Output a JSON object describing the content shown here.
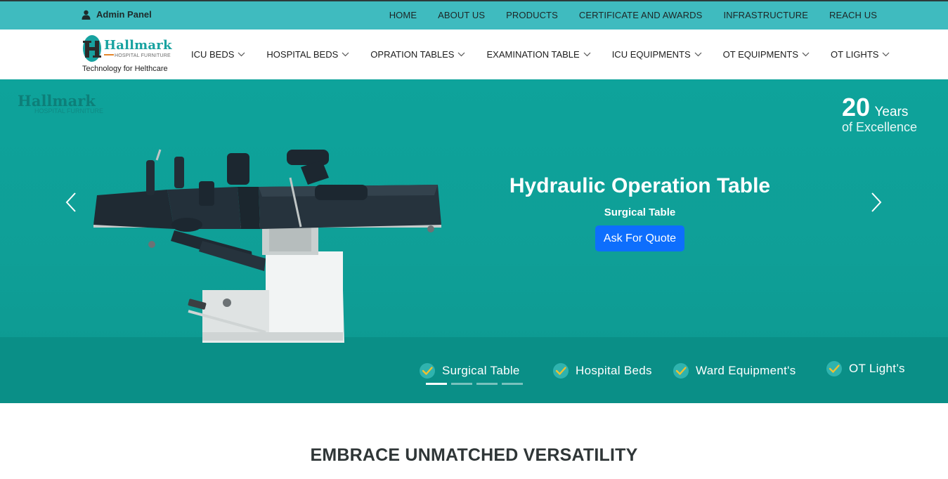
{
  "topbar": {
    "admin_label": "Admin Panel",
    "admin_icon": "user-icon",
    "links": [
      "HOME",
      "ABOUT US",
      "PRODUCTS",
      "CERTIFICATE AND AWARDS",
      "INFRASTRUCTURE",
      "REACH US"
    ]
  },
  "header": {
    "logo_name": "Hallmark",
    "logo_sub": "HOSPITAL FURNITURE",
    "logo_tagline": "Technology for Helthcare",
    "nav": [
      "ICU BEDS",
      "HOSPITAL BEDS",
      "OPRATION TABLES",
      "EXAMINATION TABLE",
      "ICU EQUIPMENTS",
      "OT EQUIPMENTS",
      "OT LIGHTS"
    ]
  },
  "hero": {
    "watermark_name": "Hallmark",
    "watermark_sub": "HOSPITAL FURNITURE",
    "years_number": "20",
    "years_word": "Years",
    "years_sub": "of Excellence",
    "slide_title": "Hydraulic Operation Table",
    "slide_subtitle": "Surgical Table",
    "quote_button": "Ask For Quote",
    "features": [
      "Surgical Table",
      "Hospital Beds",
      "Ward Equipment's",
      "OT Light’s"
    ],
    "indicator_count": 4,
    "active_indicator": 0
  },
  "section": {
    "title": "EMBRACE UNMATCHED VERSATILITY"
  },
  "colors": {
    "topbar": "#3fbbbf",
    "hero": "#0ea39b",
    "brand": "#17a2a0",
    "accent": "#e5862b",
    "button": "#0d6efd"
  }
}
